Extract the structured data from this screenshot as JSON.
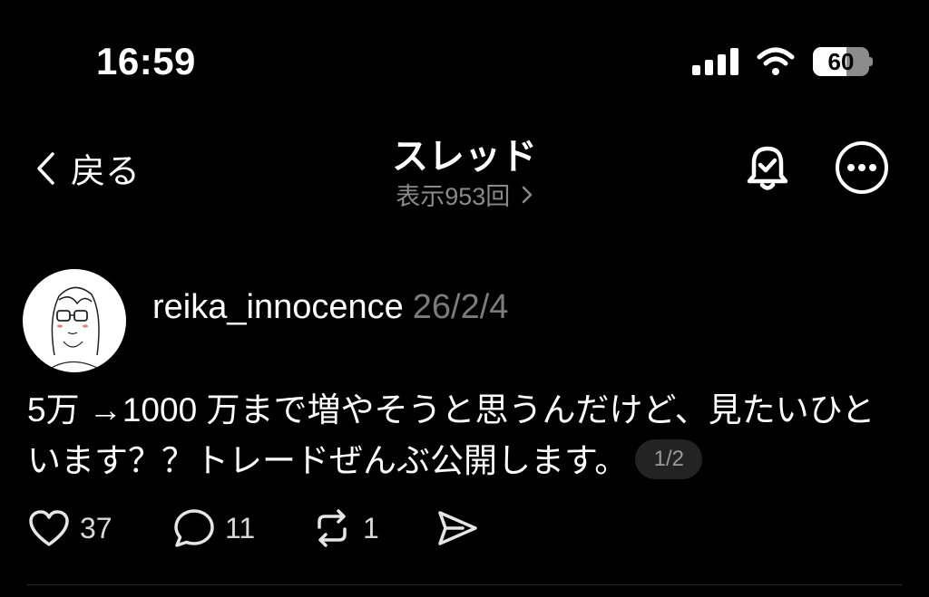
{
  "status_bar": {
    "time": "16:59",
    "battery_level": "60",
    "battery_fraction": 0.6,
    "icons": [
      "signal-icon",
      "wifi-icon",
      "battery-icon"
    ]
  },
  "nav": {
    "back_label": "戻る",
    "title": "スレッド",
    "views_label": "表示953回",
    "icons": [
      "chevron-left-icon",
      "chevron-right-icon",
      "bell-check-icon",
      "more-icon"
    ]
  },
  "post": {
    "username": "reika_innocence",
    "date": "26/2/4",
    "line1": "5万 →1000 万まで増やそうと思うんだけど、見たいひと",
    "line2": "います？？トレードぜんぶ公開します。",
    "page_indicator": "1/2",
    "actions": {
      "likes": "37",
      "replies": "11",
      "reposts": "1"
    }
  },
  "colors": {
    "background": "#000000",
    "text": "#ffffff",
    "muted": "#8a8a8a",
    "badge_bg": "#232323"
  }
}
